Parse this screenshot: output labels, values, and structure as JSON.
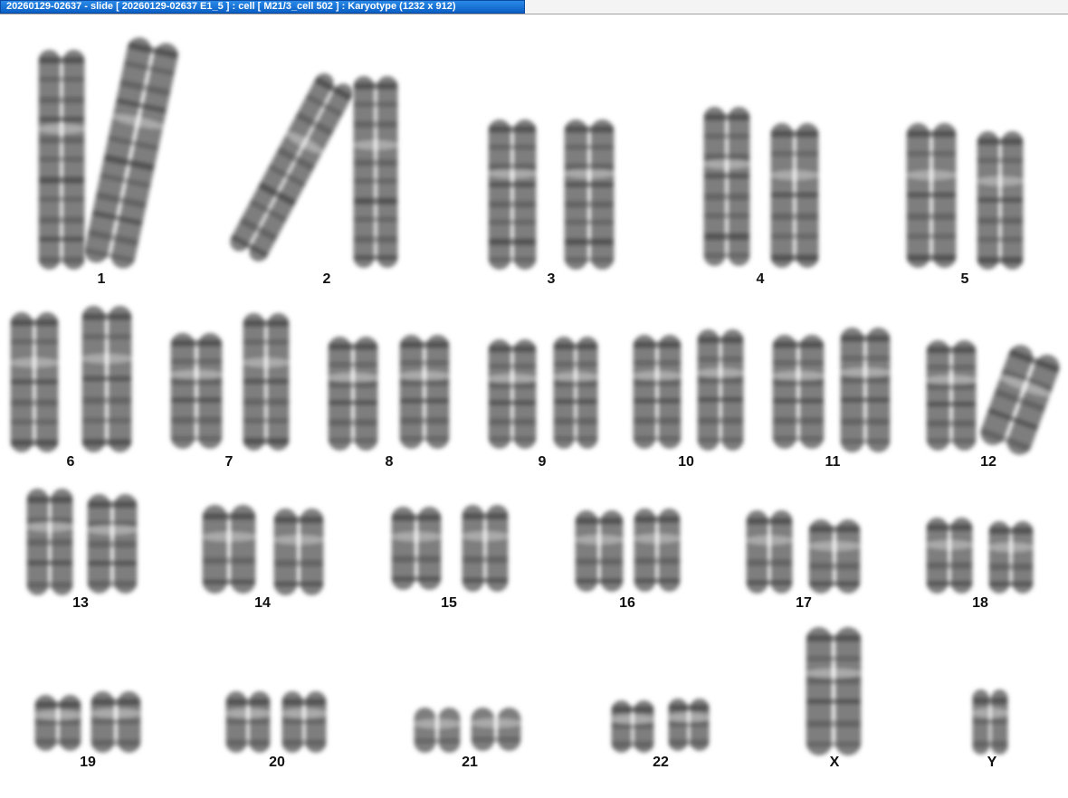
{
  "window": {
    "title": "20260129-02637 - slide [ 20260129-02637 E1_5 ] : cell [ M21/3_cell 502 ] : Karyotype  (1232 x 912)"
  },
  "colors": {
    "title_tab": "#0a5fc4",
    "chromosome": "#5a5a5a",
    "band": "#2e2e2e",
    "background": "#ffffff"
  },
  "karyotype": {
    "chromosomes": [
      {
        "label": "1"
      },
      {
        "label": "2"
      },
      {
        "label": "3"
      },
      {
        "label": "4"
      },
      {
        "label": "5"
      },
      {
        "label": "6"
      },
      {
        "label": "7"
      },
      {
        "label": "8"
      },
      {
        "label": "9"
      },
      {
        "label": "10"
      },
      {
        "label": "11"
      },
      {
        "label": "12"
      },
      {
        "label": "13"
      },
      {
        "label": "14"
      },
      {
        "label": "15"
      },
      {
        "label": "16"
      },
      {
        "label": "17"
      },
      {
        "label": "18"
      },
      {
        "label": "19"
      },
      {
        "label": "20"
      },
      {
        "label": "21"
      },
      {
        "label": "22"
      },
      {
        "label": "X"
      },
      {
        "label": "Y"
      }
    ]
  }
}
